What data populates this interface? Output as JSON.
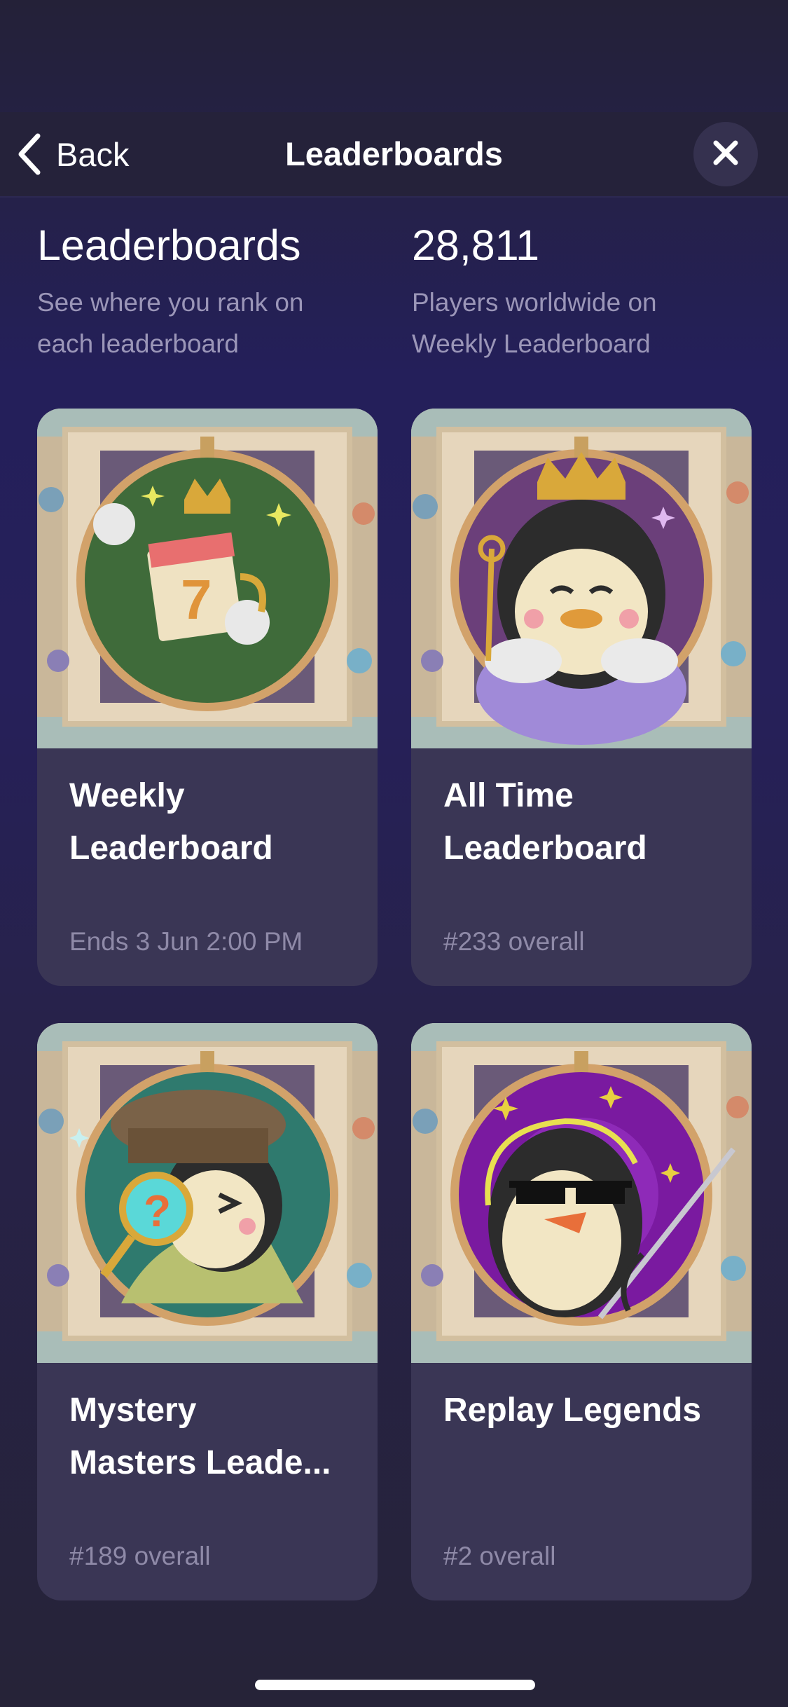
{
  "nav": {
    "back_label": "Back",
    "title": "Leaderboards"
  },
  "summary": {
    "left": {
      "heading": "Leaderboards",
      "sub_line1": "See where you rank on",
      "sub_line2": "each leaderboard"
    },
    "right": {
      "heading": "28,811",
      "sub_line1": "Players worldwide on",
      "sub_line2": "Weekly Leaderboard"
    }
  },
  "cards": [
    {
      "title_line1": "Weekly",
      "title_line2": "Leaderboard",
      "subtitle": "Ends 3 Jun 2:00 PM",
      "art_icon": "calendar-7-crown-icon",
      "hoop_color": "#3f6b3a"
    },
    {
      "title_line1": "All Time",
      "title_line2": "Leaderboard",
      "subtitle": "#233 overall",
      "art_icon": "penguin-king-icon",
      "hoop_color": "#6b3f7a"
    },
    {
      "title_line1": "Mystery",
      "title_line2": "Masters Leade...",
      "subtitle": "#189 overall",
      "art_icon": "penguin-detective-icon",
      "hoop_color": "#2f7a6e"
    },
    {
      "title_line1": "Replay Legends",
      "title_line2": "",
      "subtitle": "#2 overall",
      "art_icon": "penguin-sunglasses-icon",
      "hoop_color": "#7a1aa0"
    }
  ],
  "colors": {
    "background": "#262338",
    "card": "#3a3655",
    "muted_text": "#9b96b8",
    "accent": "#ffffff"
  }
}
